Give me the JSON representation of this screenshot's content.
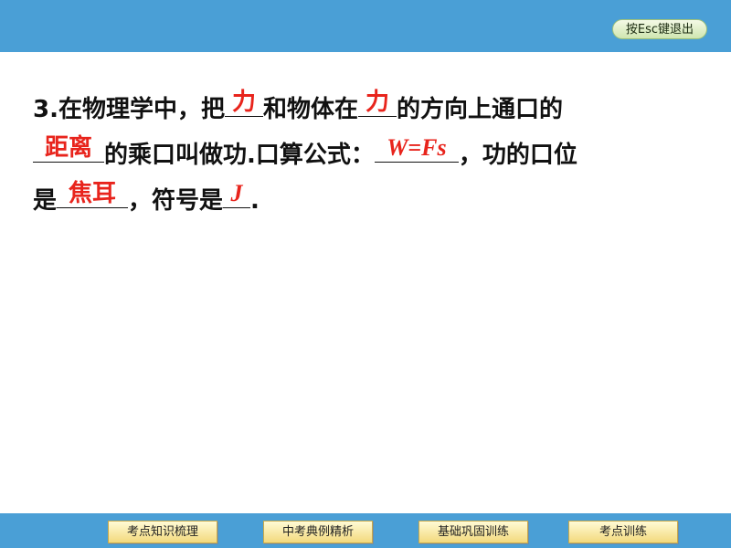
{
  "header": {
    "exit_button_label": "按Esc键退出"
  },
  "question": {
    "line1": {
      "pre": "3.在物理学中，把",
      "blank1": "力",
      "mid": "和物体在",
      "blank2": "力",
      "post": "的方向上通口的"
    },
    "line2": {
      "blank1": "距离",
      "mid": "的乘口叫做功.口算公式：",
      "blank2": "W=Fs",
      "post": "，功的口位"
    },
    "line3": {
      "pre": "是",
      "blank1": "焦耳",
      "mid": "，符号是",
      "blank2": "J",
      "post": "."
    }
  },
  "footer_nav": [
    {
      "label": "考点知识梳理"
    },
    {
      "label": "中考典例精析"
    },
    {
      "label": "基础巩固训练"
    },
    {
      "label": "考点训练"
    }
  ]
}
